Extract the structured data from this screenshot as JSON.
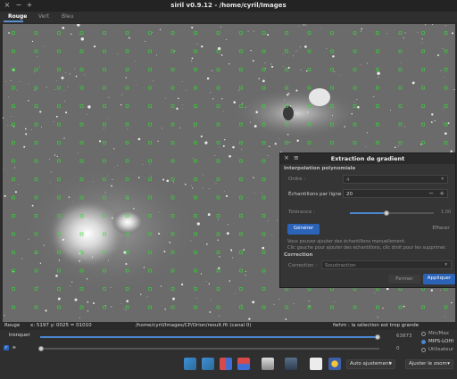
{
  "window": {
    "title": "siril v0.9.12 - /home/cyril/Images",
    "close_glyph": "×",
    "minimize_glyph": "−",
    "maximize_glyph": "+"
  },
  "tabs": [
    "Rouge",
    "Vert",
    "Bleu"
  ],
  "dialog": {
    "title": "Extraction de gradient",
    "close_glyph": "×",
    "menu_glyph": "≡",
    "section_interpolation": "Interpolation polynomiale",
    "order_label": "Ordre :",
    "order_value": "4",
    "samples_label": "Échantillons par ligne :",
    "samples_value": "20",
    "tolerance_label": "Tolérance :",
    "tolerance_value": "1.00",
    "tolerance_fraction": 0.44,
    "generate_button": "Générer",
    "clear_button": "Effacer",
    "hint_line1": "Vous pouvez ajouter des échantillons manuellement.",
    "hint_line2": "Clic gauche pour ajouter des échantillons, clic droit pour les supprimer.",
    "section_correction": "Correction",
    "correction_label": "Correction :",
    "correction_value": "Soustraction",
    "close_button": "Fermer",
    "apply_button": "Appliquer"
  },
  "status": {
    "channel": "Rouge",
    "coords": "x: 5197 y: 0025 = 01010",
    "file": "/home/cyril/Images/CP/Orion/result.fit (canal 0)",
    "fwhm": "fwhm : la sélection est trop grande"
  },
  "controls": {
    "clip_mode": "tronquer",
    "max_value": "63873",
    "min_value": "0",
    "radio_minmax": "Min/Max",
    "radio_mips": "MIPS-LOHI",
    "radio_user": "Utilisateur",
    "auto_adjust": "Auto ajustement",
    "zoom_fit": "Ajuster le zoom"
  },
  "colors": {
    "accent": "#2b63b8",
    "sample_marker": "#33dd33"
  }
}
